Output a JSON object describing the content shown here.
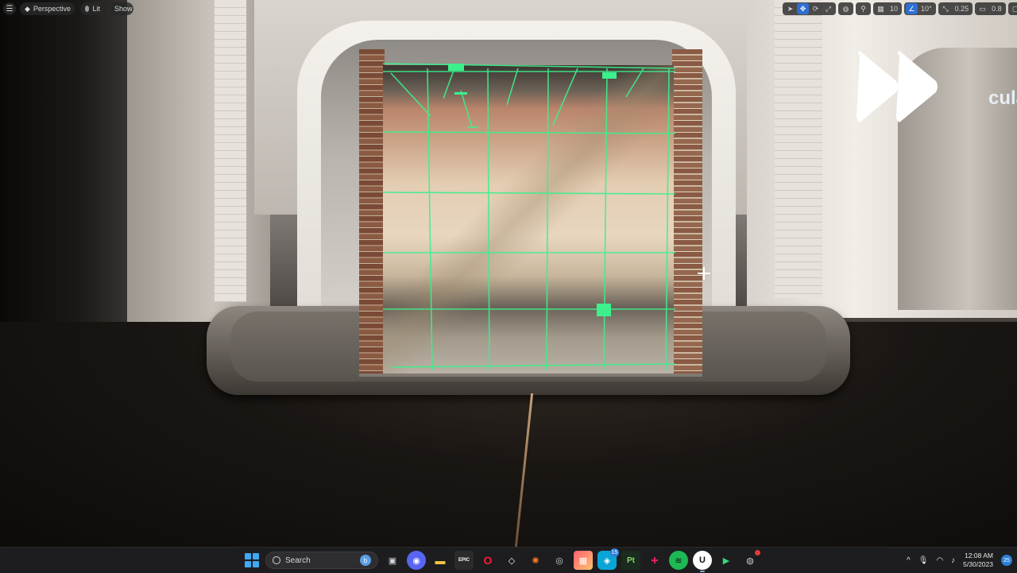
{
  "viewport": {
    "menu_icon": "hamburger-icon",
    "perspective_label": "Perspective",
    "lit_label": "Lit",
    "show_label": "Show",
    "grid_snap_value": "10",
    "rotation_snap_value": "10°",
    "scale_snap_value": "0.25",
    "camera_speed_value": "0.8",
    "overlay_text": "cula",
    "accent_color": "#2f6fd1",
    "grid_color": "#3cf08c"
  },
  "taskbar": {
    "search_placeholder": "Search",
    "bing_label": "b",
    "apps": [
      {
        "name": "task-view",
        "label": "▣"
      },
      {
        "name": "discord",
        "label": "◉"
      },
      {
        "name": "file-explorer",
        "label": "▬"
      },
      {
        "name": "epic-games",
        "label": "EPIC"
      },
      {
        "name": "opera",
        "label": "O"
      },
      {
        "name": "unity",
        "label": "◇"
      },
      {
        "name": "blender",
        "label": "✺"
      },
      {
        "name": "steam",
        "label": "◎"
      },
      {
        "name": "photos",
        "label": "▦"
      },
      {
        "name": "ubisoft",
        "label": "◈"
      },
      {
        "name": "painter",
        "label": "Pt"
      },
      {
        "name": "slack",
        "label": "✚"
      },
      {
        "name": "spotify",
        "label": "≋"
      },
      {
        "name": "unreal-engine",
        "label": "U"
      },
      {
        "name": "rider",
        "label": "▶"
      },
      {
        "name": "github",
        "label": "◍"
      }
    ],
    "ubisoft_badge": "15",
    "tray_chevron": "^",
    "time": "12:08 AM",
    "date": "5/30/2023",
    "notification_count": "25"
  }
}
